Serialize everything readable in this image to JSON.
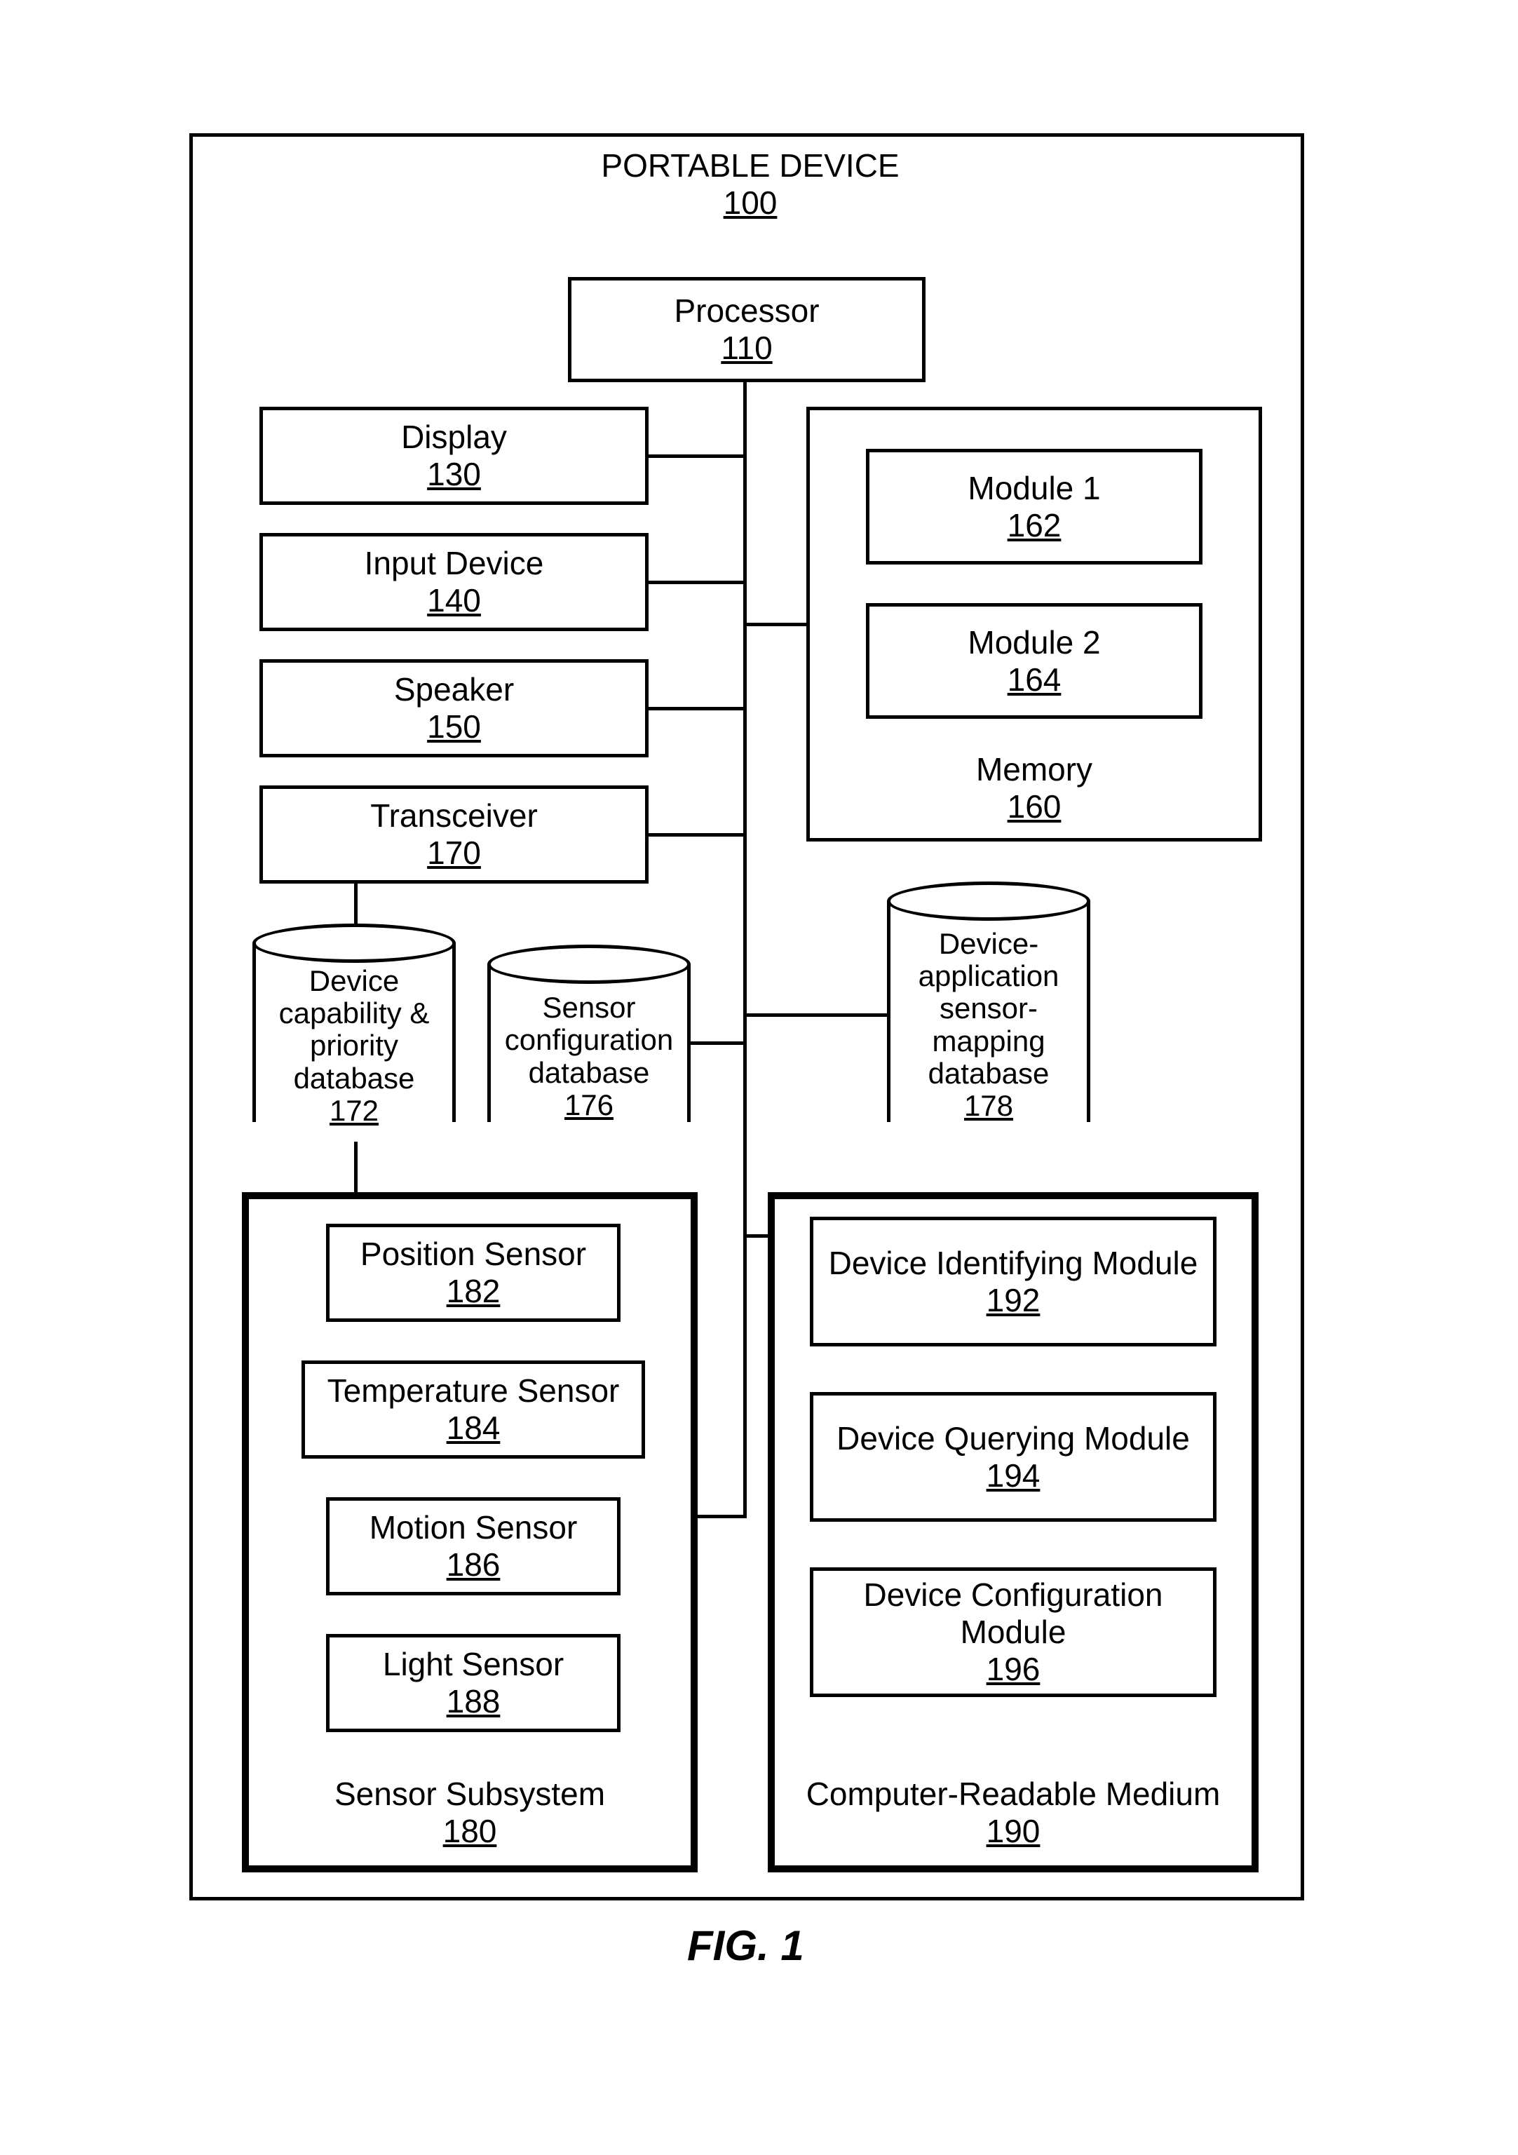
{
  "figure_caption": "FIG. 1",
  "container": {
    "title": "PORTABLE DEVICE",
    "num": "100"
  },
  "processor": {
    "title": "Processor",
    "num": "110"
  },
  "display": {
    "title": "Display",
    "num": "130"
  },
  "input": {
    "title": "Input Device",
    "num": "140"
  },
  "speaker": {
    "title": "Speaker",
    "num": "150"
  },
  "transceiver": {
    "title": "Transceiver",
    "num": "170"
  },
  "memory": {
    "title": "Memory",
    "num": "160",
    "module1": {
      "title": "Module 1",
      "num": "162"
    },
    "module2": {
      "title": "Module 2",
      "num": "164"
    }
  },
  "db_capability": {
    "l1": "Device",
    "l2": "capability &",
    "l3": "priority",
    "l4": "database",
    "num": "172"
  },
  "db_sensorcfg": {
    "l1": "Sensor",
    "l2": "configuration",
    "l3": "database",
    "num": "176"
  },
  "db_mapping": {
    "l1": "Device-",
    "l2": "application",
    "l3": "sensor-",
    "l4": "mapping",
    "l5": "database",
    "num": "178"
  },
  "sensor_sub": {
    "title": "Sensor Subsystem",
    "num": "180",
    "position": {
      "title": "Position Sensor",
      "num": "182"
    },
    "temperature": {
      "title": "Temperature Sensor",
      "num": "184"
    },
    "motion": {
      "title": "Motion Sensor",
      "num": "186"
    },
    "light": {
      "title": "Light Sensor",
      "num": "188"
    }
  },
  "crm": {
    "title": "Computer-Readable Medium",
    "num": "190",
    "identify": {
      "title": "Device Identifying Module",
      "num": "192"
    },
    "query": {
      "title": "Device Querying Module",
      "num": "194"
    },
    "config": {
      "title": "Device Configuration Module",
      "num": "196"
    }
  }
}
